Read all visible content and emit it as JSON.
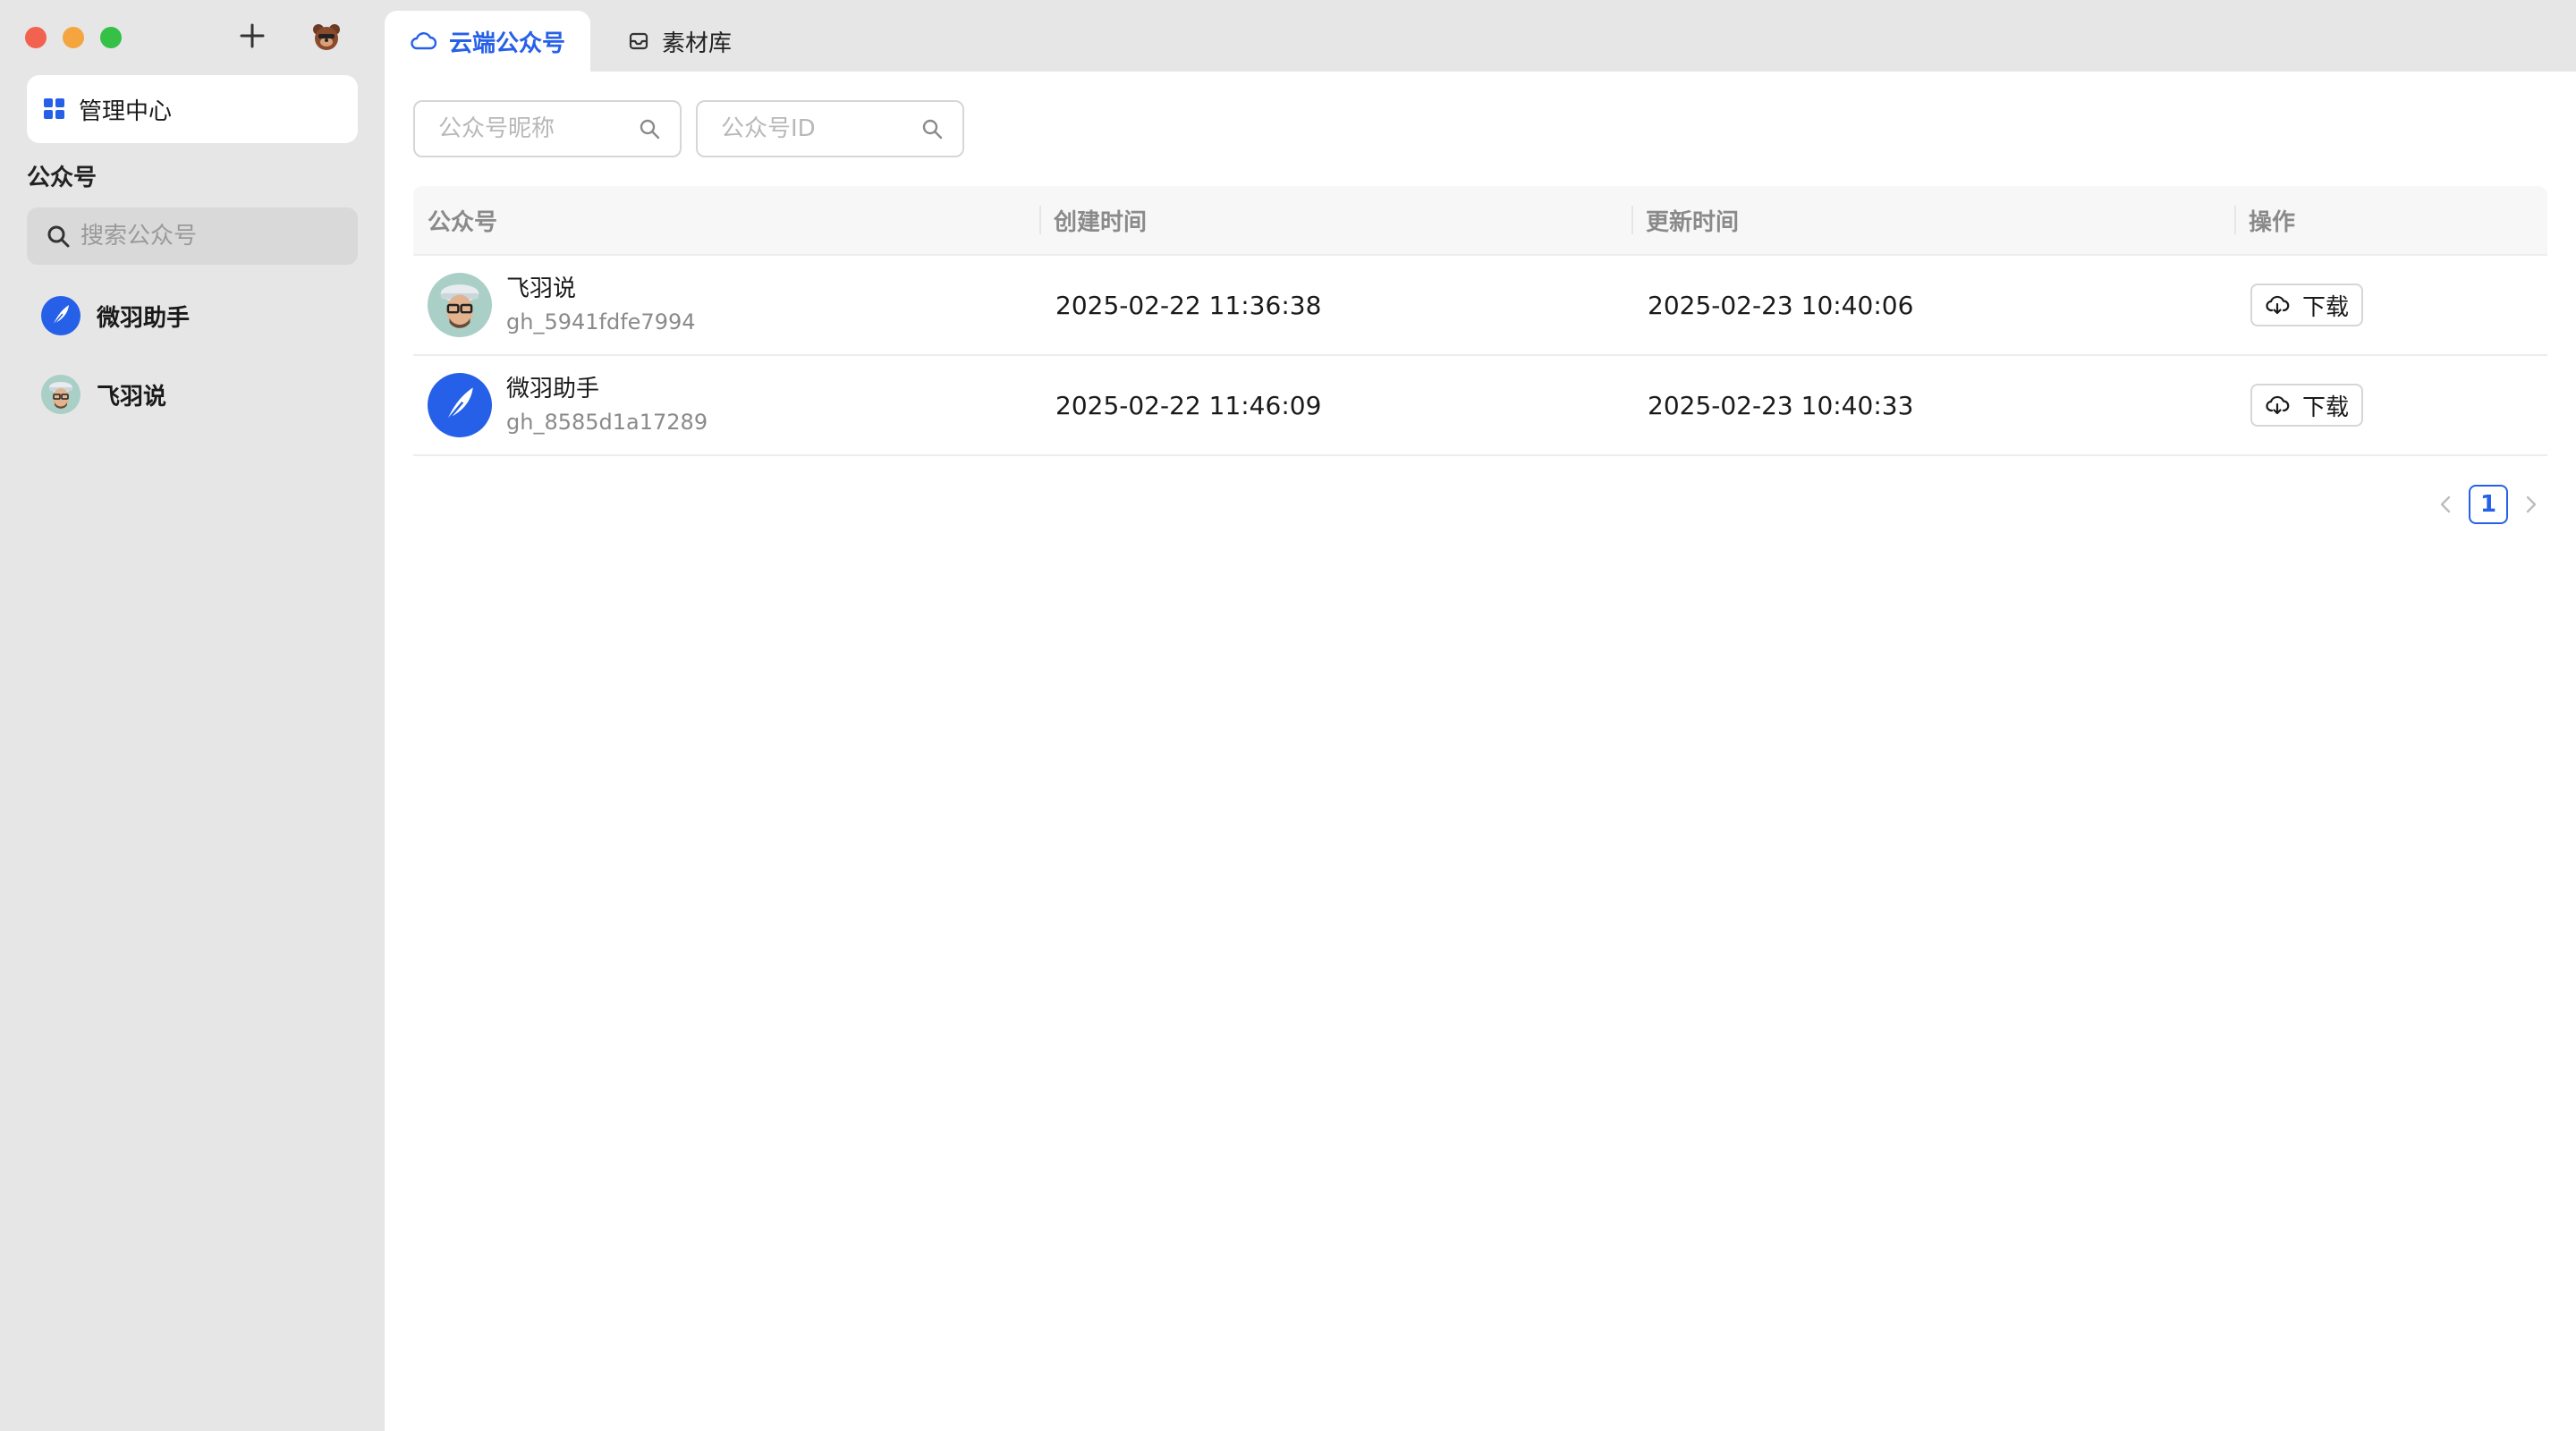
{
  "window": {
    "traffic_lights": {
      "close": "#f2624f",
      "minimize": "#f5a540",
      "maximize": "#35c046"
    }
  },
  "sidebar": {
    "add_icon": "plus-icon",
    "admin_item": {
      "label": "管理中心",
      "icon": "grid-icon",
      "icon_color": "#2660e8"
    },
    "section_title": "公众号",
    "search": {
      "placeholder": "搜索公众号"
    },
    "accounts": [
      {
        "name": "微羽助手",
        "icon": "feather-logo"
      },
      {
        "name": "飞羽说",
        "icon": "avatar-photo"
      }
    ]
  },
  "tabs": [
    {
      "label": "云端公众号",
      "icon": "cloud-icon",
      "active": true
    },
    {
      "label": "素材库",
      "icon": "inbox-icon",
      "active": false
    }
  ],
  "filters": {
    "nickname_placeholder": "公众号昵称",
    "id_placeholder": "公众号ID"
  },
  "table": {
    "headers": [
      "公众号",
      "创建时间",
      "更新时间",
      "操作"
    ],
    "rows": [
      {
        "name": "飞羽说",
        "id": "gh_5941fdfe7994",
        "created": "2025-02-22 11:36:38",
        "updated": "2025-02-23 10:40:06",
        "action": "下载"
      },
      {
        "name": "微羽助手",
        "id": "gh_8585d1a17289",
        "created": "2025-02-22 11:46:09",
        "updated": "2025-02-23 10:40:33",
        "action": "下载"
      }
    ]
  },
  "pagination": {
    "current": "1"
  },
  "colors": {
    "accent": "#2660e8",
    "sidebar_bg": "#e6e6e6"
  }
}
